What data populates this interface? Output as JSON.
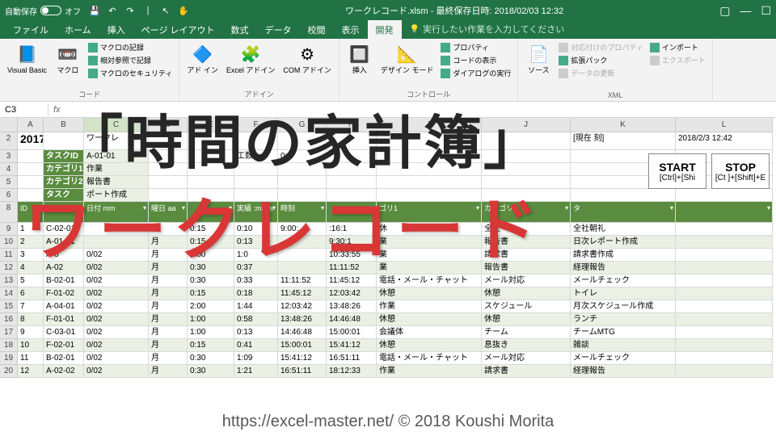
{
  "titlebar": {
    "autosave": "自動保存",
    "off": "オフ",
    "title": "ワークレコード.xlsm - 最終保存日時: 2018/02/03 12:32"
  },
  "tabs": [
    "ファイル",
    "ホーム",
    "挿入",
    "ページ レイアウト",
    "数式",
    "データ",
    "校閲",
    "表示",
    "開発"
  ],
  "active_tab": "開発",
  "tellme": "実行したい作業を入力してください",
  "ribbon": {
    "code": {
      "vb": "Visual Basic",
      "macro": "マクロ",
      "rec": "マクロの記録",
      "rel": "相対参照で記録",
      "sec": "マクロのセキュリティ",
      "label": "コード"
    },
    "addins": {
      "addin": "アド\nイン",
      "excel": "Excel\nアドイン",
      "com": "COM\nアドイン",
      "label": "アドイン"
    },
    "controls": {
      "insert": "挿入",
      "design": "デザイン\nモード",
      "prop": "プロパティ",
      "view": "コードの表示",
      "dialog": "ダイアログの実行",
      "label": "コントロール"
    },
    "xml": {
      "source": "ソース",
      "mapprop": "対応付けのプロパティ",
      "exp": "拡張パック",
      "refresh": "データの更新",
      "import": "インポート",
      "export": "エクスポート",
      "label": "XML"
    }
  },
  "namebox": "C3",
  "formula": "",
  "cols": [
    "A",
    "B",
    "C",
    "D",
    "E",
    "F",
    "G",
    "H",
    "I",
    "J",
    "K",
    "L"
  ],
  "topband": {
    "month": "2017/10",
    "title": "ワークレ",
    "current": "[現在     刻]",
    "now": "2018/2/3 12:42"
  },
  "inforows": [
    {
      "l": "タスクID",
      "v": "A-01-01",
      "extra1": "工数",
      "extra2": "0:1"
    },
    {
      "l": "カテゴリ1",
      "v": "作業"
    },
    {
      "l": "カテゴリ2",
      "v": "報告書"
    },
    {
      "l": "タスク",
      "v": "ポート作成"
    }
  ],
  "start": {
    "big": "START",
    "sub": "[Ctrl]+[Shi"
  },
  "stop": {
    "big": "STOP",
    "sub": "[Ct  ]+[Shift]+E"
  },
  "tblhdr": [
    "ID",
    "ID",
    "日付\nmm",
    "曜日\naa",
    "\n",
    "実績\n :mm:s",
    "時刻\n",
    "\n",
    "ゴリ1",
    "カテゴリ2",
    "タ"
  ],
  "rows": [
    {
      "n": 9,
      "d": [
        "1",
        "C-02-01",
        "",
        "月",
        "0:15",
        "0:10",
        "9:00:",
        "   :16:1",
        "休",
        "全社",
        "全社朝礼"
      ]
    },
    {
      "n": 10,
      "d": [
        "2",
        "A-01-01",
        "",
        "月",
        "0:15",
        "0:13",
        "",
        "9:30:1",
        "業",
        "報告書",
        "日次レポート作成"
      ]
    },
    {
      "n": 11,
      "d": [
        "3",
        "A-0",
        "0/02",
        "月",
        "1:00",
        "1:0",
        "",
        "10:33:55",
        "業",
        "請求書",
        "請求書作成"
      ]
    },
    {
      "n": 12,
      "d": [
        "4",
        "A-02",
        "0/02",
        "月",
        "0:30",
        "0:37",
        "",
        "11:11:52",
        "業",
        "報告書",
        "経理報告"
      ]
    },
    {
      "n": 13,
      "d": [
        "5",
        "B-02-01",
        "0/02",
        "月",
        "0:30",
        "0:33",
        "11:11:52",
        "11:45:12",
        "電話・メール・チャット",
        "メール対応",
        "メールチェック"
      ]
    },
    {
      "n": 14,
      "d": [
        "6",
        "F-01-02",
        "0/02",
        "月",
        "0:15",
        "0:18",
        "11:45:12",
        "12:03:42",
        "休憩",
        "休憩",
        "トイレ"
      ]
    },
    {
      "n": 15,
      "d": [
        "7",
        "A-04-01",
        "0/02",
        "月",
        "2:00",
        "1:44",
        "12:03:42",
        "13:48:26",
        "作業",
        "スケジュール",
        "月次スケジュール作成"
      ]
    },
    {
      "n": 16,
      "d": [
        "8",
        "F-01-01",
        "0/02",
        "月",
        "1:00",
        "0:58",
        "13:48:26",
        "14:46:48",
        "休憩",
        "休憩",
        "ランチ"
      ]
    },
    {
      "n": 17,
      "d": [
        "9",
        "C-03-01",
        "0/02",
        "月",
        "1:00",
        "0:13",
        "14:46:48",
        "15:00:01",
        "会議体",
        "チーム",
        "チームMTG"
      ]
    },
    {
      "n": 18,
      "d": [
        "10",
        "F-02-01",
        "0/02",
        "月",
        "0:15",
        "0:41",
        "15:00:01",
        "15:41:12",
        "休憩",
        "息抜き",
        "雑談"
      ]
    },
    {
      "n": 19,
      "d": [
        "11",
        "B-02-01",
        "0/02",
        "月",
        "0:30",
        "1:09",
        "15:41:12",
        "16:51:11",
        "電話・メール・チャット",
        "メール対応",
        "メールチェック"
      ]
    },
    {
      "n": 20,
      "d": [
        "12",
        "A-02-02",
        "0/02",
        "月",
        "0:30",
        "1:21",
        "16:51:11",
        "18:12:33",
        "作業",
        "請求書",
        "経理報告"
      ]
    }
  ],
  "overlay1": "「時間の家計簿」",
  "overlay2": "ワークレコード",
  "footer": "https://excel-master.net/   © 2018 Koushi Morita"
}
